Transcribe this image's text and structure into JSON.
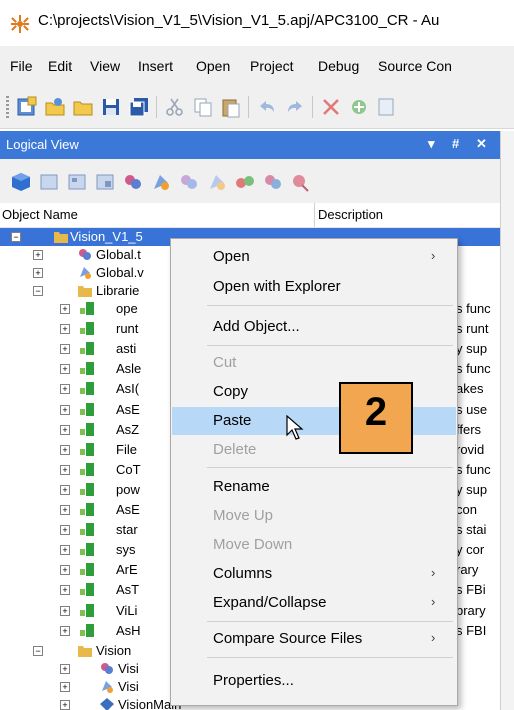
{
  "window": {
    "title": "C:\\projects\\Vision_V1_5\\Vision_V1_5.apj/APC3100_CR - Au"
  },
  "menubar": {
    "items": [
      "File",
      "Edit",
      "View",
      "Insert",
      "Open",
      "Project",
      "Debug",
      "Source Con"
    ]
  },
  "panel": {
    "title": "Logical View",
    "controls": {
      "pin": "▾",
      "dock": "#",
      "close": "✕"
    }
  },
  "columns": {
    "name": "Object Name",
    "description": "Description"
  },
  "tree": {
    "root": "Vision_V1_5",
    "rows": [
      {
        "label": "Global.t",
        "desc": ""
      },
      {
        "label": "Global.v",
        "desc": ""
      },
      {
        "label": "Librarie",
        "desc": ""
      },
      {
        "label": "ope",
        "desc": "s func"
      },
      {
        "label": "runt",
        "desc": "s runt"
      },
      {
        "label": "asti",
        "desc": "y sup"
      },
      {
        "label": "Asle",
        "desc": "s func"
      },
      {
        "label": "AsI(",
        "desc": "akes"
      },
      {
        "label": "AsE",
        "desc": "s use"
      },
      {
        "label": "AsZ",
        "desc": "ffers"
      },
      {
        "label": "File",
        "desc": "rovid"
      },
      {
        "label": "CoT",
        "desc": "s func"
      },
      {
        "label": "pow",
        "desc": "y sup"
      },
      {
        "label": "AsE",
        "desc": "con"
      },
      {
        "label": "star",
        "desc": "s stai"
      },
      {
        "label": "sys",
        "desc": "y cor"
      },
      {
        "label": "ArE",
        "desc": "rary"
      },
      {
        "label": "AsT",
        "desc": "s FBi"
      },
      {
        "label": "ViLi",
        "desc": "brary"
      },
      {
        "label": "AsH",
        "desc": "s FBI"
      },
      {
        "label": "Vision",
        "desc": ""
      },
      {
        "label": "Visi",
        "desc": ""
      },
      {
        "label": "Visi",
        "desc": ""
      },
      {
        "label": "VisionMain",
        "desc": ""
      }
    ]
  },
  "context_menu": {
    "open": "Open",
    "open_with_explorer": "Open with Explorer",
    "add_object": "Add Object...",
    "cut": "Cut",
    "copy": "Copy",
    "paste": "Paste",
    "delete": "Delete",
    "rename": "Rename",
    "move_up": "Move Up",
    "move_down": "Move Down",
    "columns": "Columns",
    "expand_collapse": "Expand/Collapse",
    "compare_source_files": "Compare Source Files",
    "properties": "Properties...",
    "submenu_arrow": "›"
  },
  "callout": {
    "number": "2"
  },
  "colors": {
    "selection": "#3a73d8",
    "panel_header": "#3b78d8",
    "hover": "#b8d8f8",
    "callout": "#f3a650"
  }
}
